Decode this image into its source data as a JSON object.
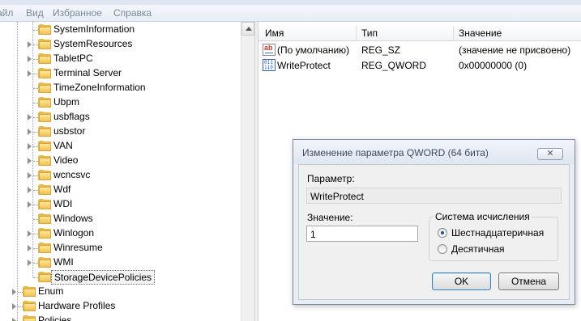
{
  "menu": [
    "айл",
    "Вид",
    "Избранное",
    "Справка"
  ],
  "tree": {
    "items": [
      {
        "label": "SystemInformation",
        "expandable": false
      },
      {
        "label": "SystemResources",
        "expandable": true
      },
      {
        "label": "TabletPC",
        "expandable": true
      },
      {
        "label": "Terminal Server",
        "expandable": true
      },
      {
        "label": "TimeZoneInformation",
        "expandable": false
      },
      {
        "label": "Ubpm",
        "expandable": false
      },
      {
        "label": "usbflags",
        "expandable": true
      },
      {
        "label": "usbstor",
        "expandable": true
      },
      {
        "label": "VAN",
        "expandable": true
      },
      {
        "label": "Video",
        "expandable": true
      },
      {
        "label": "wcncsvc",
        "expandable": true
      },
      {
        "label": "Wdf",
        "expandable": true
      },
      {
        "label": "WDI",
        "expandable": true
      },
      {
        "label": "Windows",
        "expandable": false
      },
      {
        "label": "Winlogon",
        "expandable": true
      },
      {
        "label": "Winresume",
        "expandable": true
      },
      {
        "label": "WMI",
        "expandable": true
      },
      {
        "label": "StorageDevicePolicies",
        "expandable": false,
        "selected": true
      }
    ],
    "root_items": [
      {
        "label": "Enum",
        "expandable": true
      },
      {
        "label": "Hardware Profiles",
        "expandable": true
      },
      {
        "label": "Policies",
        "expandable": true
      }
    ]
  },
  "list": {
    "columns": [
      "Имя",
      "Тип",
      "Значение"
    ],
    "rows": [
      {
        "icon": "string-value-icon",
        "name": "(По умолчанию)",
        "type": "REG_SZ",
        "value": "(значение не присвоено)"
      },
      {
        "icon": "binary-value-icon",
        "name": "WriteProtect",
        "type": "REG_QWORD",
        "value": "0x00000000 (0)"
      }
    ]
  },
  "dialog": {
    "title": "Изменение параметра QWORD (64 бита)",
    "close_glyph": "✕",
    "param_label": "Параметр:",
    "param_value": "WriteProtect",
    "value_label": "Значение:",
    "value_input": "1",
    "base_group_label": "Система исчисления",
    "radio_hex": "Шестнадцатеричная",
    "radio_dec": "Десятичная",
    "selected_base": "hex",
    "ok_label": "OK",
    "cancel_label": "Отмена"
  }
}
